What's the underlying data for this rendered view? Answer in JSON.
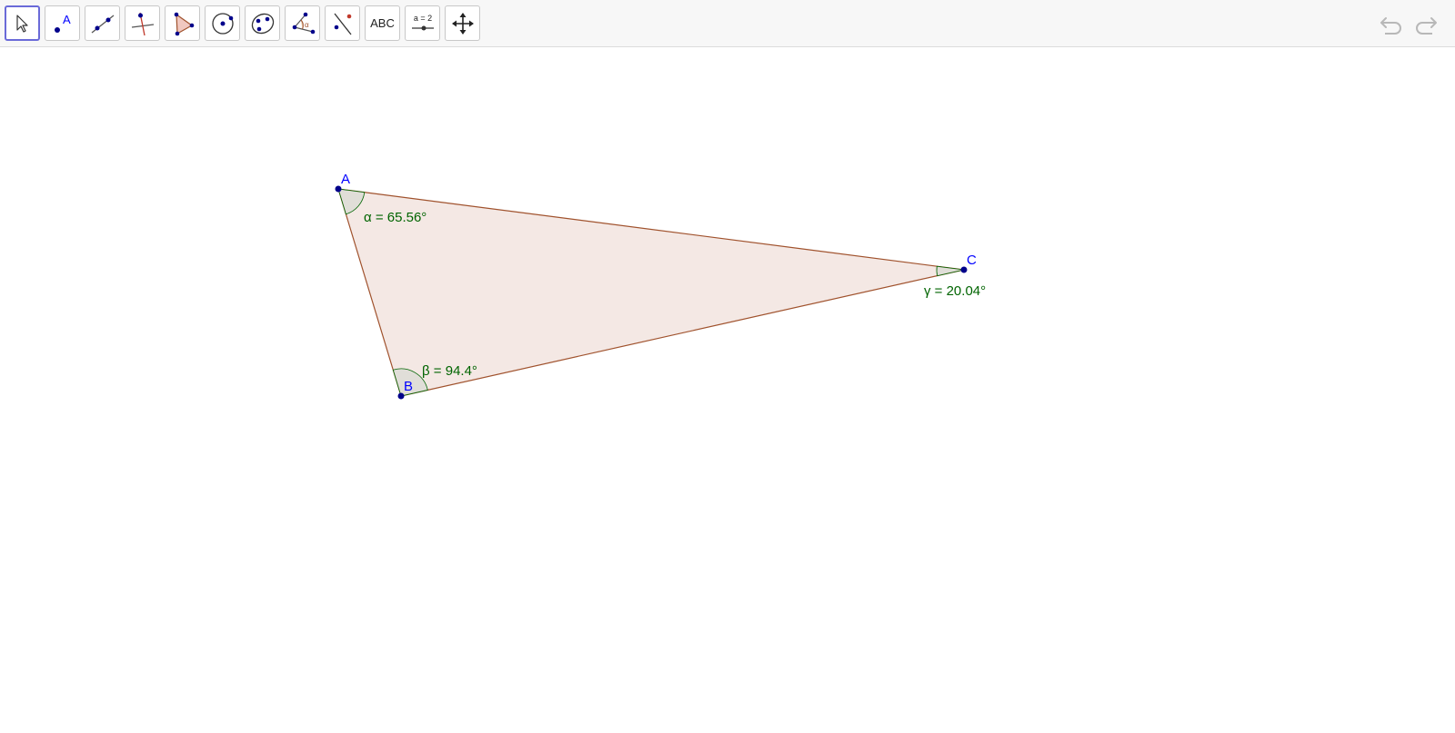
{
  "toolbar": {
    "tools": [
      {
        "name": "move-tool",
        "icon": "arrow-cursor-icon",
        "selected": true
      },
      {
        "name": "point-tool",
        "icon": "point-icon",
        "label": "A"
      },
      {
        "name": "line-tool",
        "icon": "line-icon"
      },
      {
        "name": "perpendicular-tool",
        "icon": "perpendicular-line-icon"
      },
      {
        "name": "polygon-tool",
        "icon": "polygon-icon"
      },
      {
        "name": "circle-tool",
        "icon": "circle-icon"
      },
      {
        "name": "conic-tool",
        "icon": "ellipse-icon"
      },
      {
        "name": "angle-tool",
        "icon": "angle-icon",
        "label": "α"
      },
      {
        "name": "reflect-tool",
        "icon": "reflect-icon"
      },
      {
        "name": "text-tool",
        "icon": "text-icon",
        "label": "ABC"
      },
      {
        "name": "slider-tool",
        "icon": "slider-icon",
        "label": "a = 2"
      },
      {
        "name": "move-graphics-tool",
        "icon": "move-view-icon"
      }
    ],
    "undo": {
      "icon": "undo-icon"
    },
    "redo": {
      "icon": "redo-icon"
    }
  },
  "construction": {
    "colors": {
      "point": "#00008b",
      "point_label": "#0000ff",
      "edge": "#a0522d",
      "fill": "#f4e8e4",
      "angle_fill": "#dcdcd6",
      "angle_stroke": "#006400",
      "angle_label": "#006400"
    },
    "points": [
      {
        "label": "A"
      },
      {
        "label": "B"
      },
      {
        "label": "C"
      }
    ],
    "angles": [
      {
        "vertex": "A",
        "label": "α = 65.56°"
      },
      {
        "vertex": "B",
        "label": "β = 94.4°"
      },
      {
        "vertex": "C",
        "label": "γ = 20.04°"
      }
    ]
  }
}
